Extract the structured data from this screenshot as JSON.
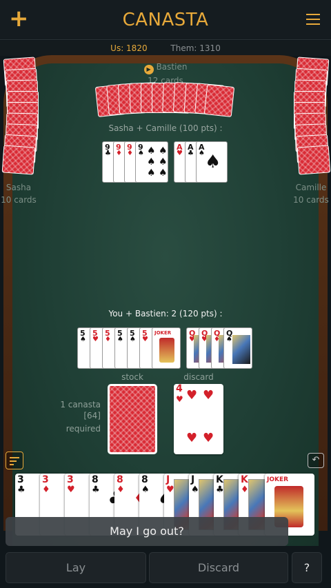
{
  "header": {
    "title": "CANASTA",
    "add_icon": "plus-icon",
    "menu_icon": "hamburger-icon"
  },
  "scores": {
    "us": "Us: 1820",
    "them": "Them: 1310"
  },
  "players": {
    "north": {
      "name": "Bastien",
      "cards": "12 cards"
    },
    "west": {
      "name": "Sasha",
      "cards": "10 cards"
    },
    "east": {
      "name": "Camille",
      "cards": "10 cards"
    }
  },
  "opponent_melds": {
    "label": "Sasha + Camille (100 pts) :"
  },
  "my_melds": {
    "label": "You + Bastien: 2 (120 pts) :"
  },
  "piles": {
    "stock_label": "stock",
    "discard_label": "discard",
    "discard_top": {
      "rank": "4",
      "suit": "♥"
    }
  },
  "requirement": {
    "line1": "1 canasta",
    "line2": "[64]",
    "line3": "required"
  },
  "toast": {
    "text": "May I go out?"
  },
  "buttons": {
    "lay": "Lay",
    "discard": "Discard",
    "help": "?"
  },
  "colors": {
    "accent": "#e7a93a",
    "felt": "#1f3f35",
    "card_back": "#d92b35"
  }
}
